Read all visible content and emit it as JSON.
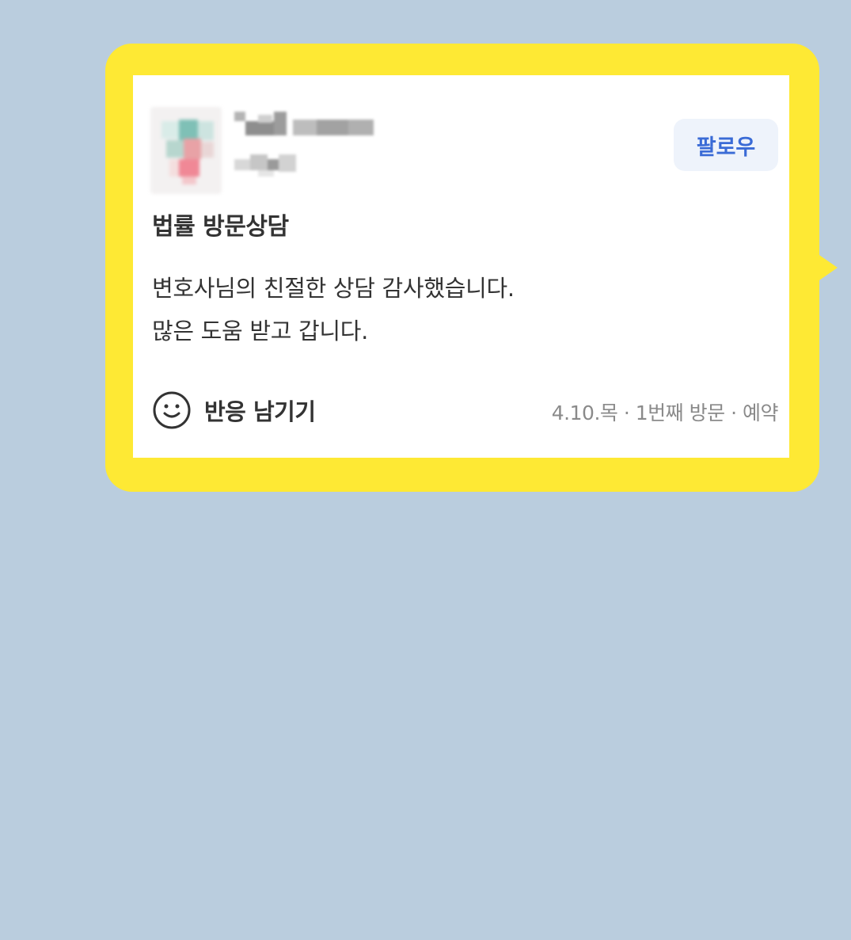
{
  "review": {
    "follow_label": "팔로우",
    "title": "법률 방문상담",
    "content_lines": [
      "변호사님의 친절한 상담 감사했습니다.",
      "많은 도움 받고 갑니다."
    ],
    "react_label": "반응 남기기",
    "meta": {
      "date": "4.10.목",
      "visit": "1번째 방문",
      "type": "예약"
    }
  },
  "icons": {
    "react": "smiley-icon"
  },
  "colors": {
    "background": "#bacdde",
    "bubble": "#fee934",
    "follow_text": "#3a6bd6",
    "follow_bg": "#eef3fb"
  }
}
